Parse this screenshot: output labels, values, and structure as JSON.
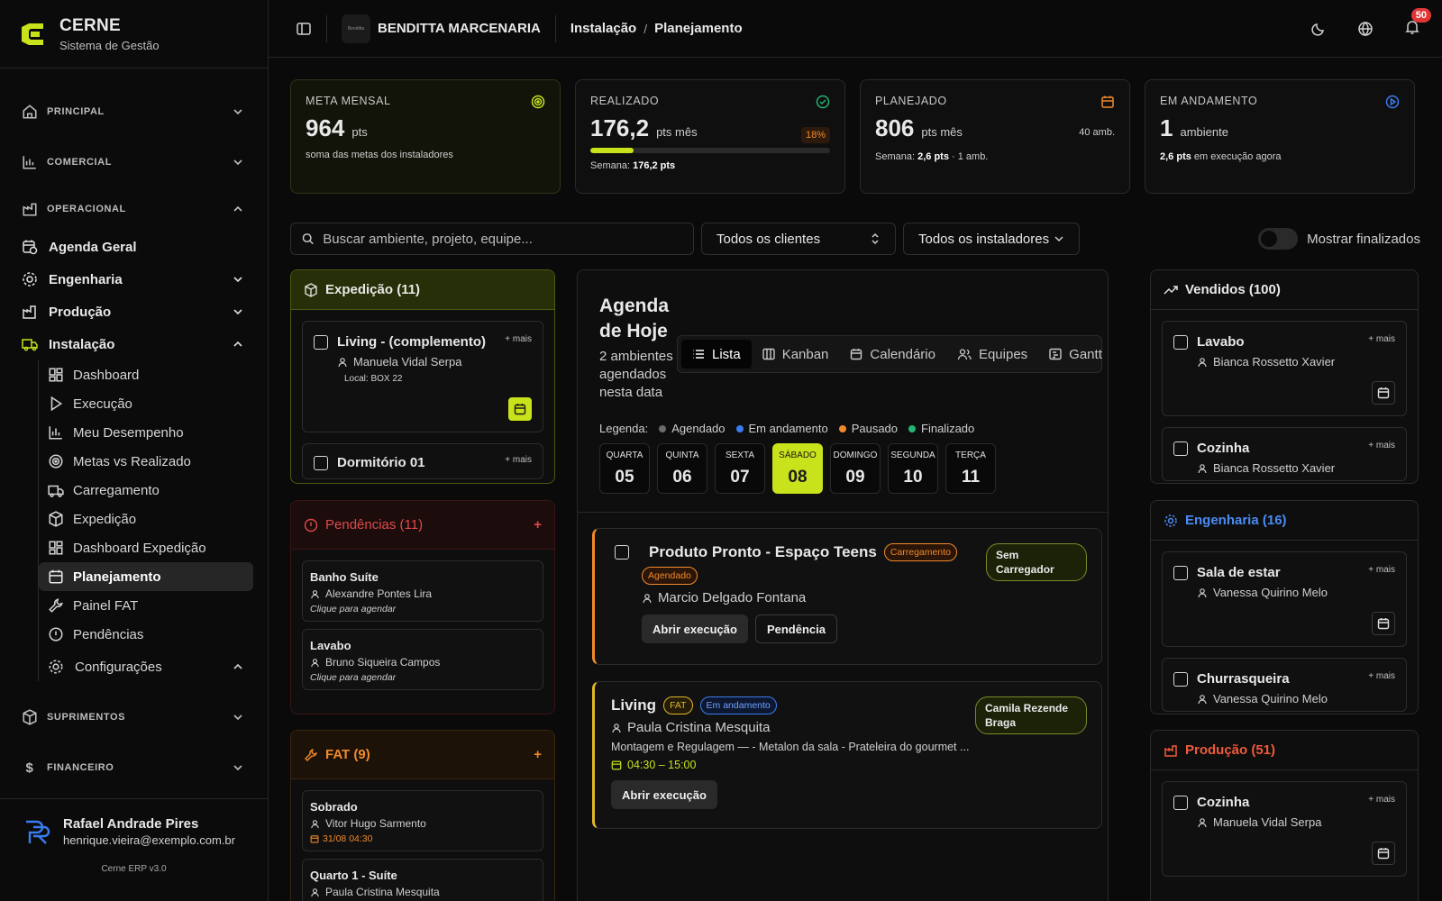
{
  "brand": {
    "name": "CERNE",
    "subtitle": "Sistema de Gestão"
  },
  "sidebar": {
    "sections": [
      {
        "label": "PRINCIPAL"
      },
      {
        "label": "COMERCIAL"
      },
      {
        "label": "OPERACIONAL"
      },
      {
        "label": "SUPRIMENTOS"
      },
      {
        "label": "FINANCEIRO"
      }
    ],
    "operacional_items": [
      {
        "label": "Agenda Geral"
      },
      {
        "label": "Engenharia"
      },
      {
        "label": "Produção"
      },
      {
        "label": "Instalação"
      }
    ],
    "instalacao_items": [
      {
        "label": "Dashboard"
      },
      {
        "label": "Execução"
      },
      {
        "label": "Meu Desempenho"
      },
      {
        "label": "Metas vs Realizado"
      },
      {
        "label": "Carregamento"
      },
      {
        "label": "Expedição"
      },
      {
        "label": "Dashboard Expedição"
      },
      {
        "label": "Planejamento"
      },
      {
        "label": "Painel FAT"
      },
      {
        "label": "Pendências"
      },
      {
        "label": "Configurações"
      }
    ]
  },
  "user": {
    "name": "Rafael Andrade Pires",
    "email": "henrique.vieira@exemplo.com.br",
    "version": "Cerne ERP v3.0"
  },
  "topbar": {
    "company": "BENDITTA MARCENARIA",
    "company_logo_text": "Benditta",
    "crumb1": "Instalação",
    "crumb_sep": "/",
    "crumb2": "Planejamento",
    "notifications": "50"
  },
  "stats": [
    {
      "label": "META MENSAL",
      "value": "964",
      "unit": "pts",
      "note": "soma das metas dos instaladores"
    },
    {
      "label": "REALIZADO",
      "value": "176,2",
      "unit": "pts mês",
      "pct": "18%",
      "progress": 0.18,
      "week_label": "Semana:",
      "week_value": "176,2 pts"
    },
    {
      "label": "PLANEJADO",
      "value": "806",
      "unit": "pts mês",
      "amb": "40 amb.",
      "week_label": "Semana:",
      "week_value": "2,6 pts",
      "week_extra": "· 1 amb."
    },
    {
      "label": "EM ANDAMENTO",
      "value": "1",
      "unit": "ambiente",
      "strong": "2,6 pts",
      "note": "em execução agora"
    }
  ],
  "filters": {
    "search_placeholder": "Buscar ambiente, projeto, equipe...",
    "clientes": "Todos os clientes",
    "instaladores": "Todos os instaladores",
    "toggle_label": "Mostrar finalizados"
  },
  "expedicao": {
    "title": "Expedição (11)",
    "cards": [
      {
        "title": "Living - (complemento)",
        "person": "Manuela Vidal Serpa",
        "local": "Local: BOX 22",
        "more": "+ mais"
      },
      {
        "title": "Dormitório 01",
        "more": "+ mais"
      }
    ]
  },
  "pendencias": {
    "title": "Pendências (11)",
    "add": "+",
    "cards": [
      {
        "title": "Banho Suíte",
        "person": "Alexandre Pontes Lira",
        "hint": "Clique para agendar"
      },
      {
        "title": "Lavabo",
        "person": "Bruno Siqueira Campos",
        "hint": "Clique para agendar"
      }
    ]
  },
  "fat": {
    "title": "FAT (9)",
    "add": "+",
    "cards": [
      {
        "title": "Sobrado",
        "person": "Vitor Hugo Sarmento",
        "date": "31/08 04:30"
      },
      {
        "title": "Quarto 1 - Suíte",
        "person": "Paula Cristina Mesquita"
      }
    ]
  },
  "agenda": {
    "title": "Agenda de Hoje",
    "subtitle": "2 ambientes agendados nesta data",
    "tabs": [
      {
        "label": "Lista"
      },
      {
        "label": "Kanban"
      },
      {
        "label": "Calendário"
      },
      {
        "label": "Equipes"
      },
      {
        "label": "Gantt"
      }
    ],
    "legend_label": "Legenda:",
    "legend": [
      {
        "label": "Agendado",
        "color": "#6b6b6b"
      },
      {
        "label": "Em andamento",
        "color": "#3a7cf0"
      },
      {
        "label": "Pausado",
        "color": "#f08a2b"
      },
      {
        "label": "Finalizado",
        "color": "#22b573"
      }
    ],
    "days": [
      {
        "wd": "QUARTA",
        "dn": "05"
      },
      {
        "wd": "QUINTA",
        "dn": "06"
      },
      {
        "wd": "SEXTA",
        "dn": "07"
      },
      {
        "wd": "SÁBADO",
        "dn": "08"
      },
      {
        "wd": "DOMINGO",
        "dn": "09"
      },
      {
        "wd": "SEGUNDA",
        "dn": "10"
      },
      {
        "wd": "TERÇA",
        "dn": "11"
      }
    ],
    "events": [
      {
        "title": "Produto Pronto - Espaço Teens",
        "tag1": "Carregamento",
        "tag2": "Agendado",
        "person": "Marcio Delgado Fontana",
        "pill": "Sem Carregador",
        "btn1": "Abrir execução",
        "btn2": "Pendência"
      },
      {
        "title": "Living",
        "tag1": "FAT",
        "tag2": "Em andamento",
        "person": "Paula Cristina Mesquita",
        "desc": "Montagem e Regulagem — - Metalon da sala - Prateleira do gourmet ...",
        "time": "04:30 – 15:00",
        "pill": "Camila Rezende Braga",
        "btn1": "Abrir execução"
      }
    ]
  },
  "vendidos": {
    "title": "Vendidos (100)",
    "cards": [
      {
        "title": "Lavabo",
        "person": "Bianca Rossetto Xavier",
        "more": "+ mais"
      },
      {
        "title": "Cozinha",
        "person": "Bianca Rossetto Xavier",
        "more": "+ mais"
      }
    ]
  },
  "engenharia": {
    "title": "Engenharia (16)",
    "cards": [
      {
        "title": "Sala de estar",
        "person": "Vanessa Quirino Melo",
        "more": "+ mais"
      },
      {
        "title": "Churrasqueira",
        "person": "Vanessa Quirino Melo",
        "more": "+ mais"
      }
    ]
  },
  "producao": {
    "title": "Produção (51)",
    "cards": [
      {
        "title": "Cozinha",
        "person": "Manuela Vidal Serpa",
        "more": "+ mais"
      }
    ]
  },
  "colors": {
    "accent": "#c8e21b",
    "orange": "#f08a2b",
    "red": "#e03636",
    "blue": "#3a7cf0",
    "green": "#22b573"
  }
}
